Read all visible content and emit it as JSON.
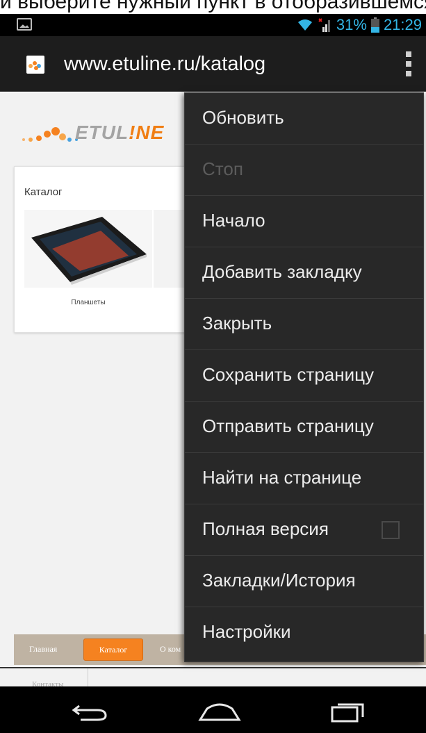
{
  "caption": {
    "text": "и выберите нужный пункт в отобразившемся меню"
  },
  "status_bar": {
    "battery_percent": "31%",
    "time": "21:29",
    "accent_color": "#33b5e5",
    "icons": [
      "notification-image-icon",
      "wifi-icon",
      "signal-icon",
      "battery-icon"
    ]
  },
  "url_bar": {
    "url": "www.etuline.ru/katalog",
    "favicon": "etuline-favicon",
    "menu_icon": "overflow-menu-icon"
  },
  "page": {
    "logo": {
      "text_prefix": "ETUL",
      "text_accent": "!NE"
    },
    "catalog": {
      "title": "Каталог",
      "products": [
        {
          "label": "Планшеты"
        }
      ]
    },
    "nav": {
      "items": [
        {
          "label": "Главная",
          "active": false
        },
        {
          "label": "Каталог",
          "active": true
        },
        {
          "label": "О ком",
          "active": false
        }
      ],
      "accent_color": "#f58220"
    },
    "footer_link": "Контакты"
  },
  "menu": {
    "items": [
      {
        "label": "Обновить",
        "enabled": true
      },
      {
        "label": "Стоп",
        "enabled": false
      },
      {
        "label": "Начало",
        "enabled": true
      },
      {
        "label": "Добавить закладку",
        "enabled": true
      },
      {
        "label": "Закрыть",
        "enabled": true
      },
      {
        "label": "Сохранить страницу",
        "enabled": true
      },
      {
        "label": "Отправить страницу",
        "enabled": true
      },
      {
        "label": "Найти на странице",
        "enabled": true
      },
      {
        "label": "Полная версия",
        "enabled": true,
        "checkbox": false
      },
      {
        "label": "Закладки/История",
        "enabled": true
      },
      {
        "label": "Настройки",
        "enabled": true
      }
    ]
  },
  "system_nav": {
    "buttons": [
      "back-icon",
      "home-icon",
      "recent-apps-icon"
    ]
  }
}
